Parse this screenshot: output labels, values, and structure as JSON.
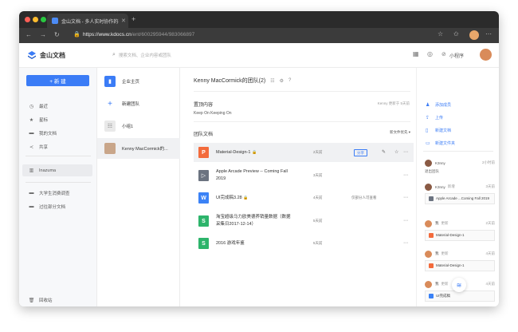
{
  "browser": {
    "tab_title": "金山文档 - 多人实时协作的在线",
    "url_host": "https://www.kdocs.cn",
    "url_path": "/ent/600295944/983066897"
  },
  "header": {
    "brand": "金山文档",
    "search_placeholder": "搜索文档、企业内容或团队",
    "mini_program": "小程序"
  },
  "sidebar": {
    "new_button": "+ 新 建",
    "items": [
      {
        "icon": "clock-icon",
        "label": "最近"
      },
      {
        "icon": "star-icon",
        "label": "星标"
      },
      {
        "icon": "folder-icon",
        "label": "我的文档"
      },
      {
        "icon": "share-icon",
        "label": "共享"
      }
    ],
    "workspace": "Inazuma",
    "folders": [
      {
        "icon": "folder-icon",
        "label": "大学生消费调查"
      },
      {
        "icon": "folder-icon",
        "label": "过往部分文档"
      }
    ],
    "trash": "回收站"
  },
  "teams": {
    "items": [
      {
        "icon": "building-icon",
        "label": "企业主页"
      },
      {
        "icon": "plus-icon",
        "label": "新建团队"
      },
      {
        "icon": "group-icon",
        "label": "小组1"
      },
      {
        "icon": "team-avatar-icon",
        "label": "Kenny MacCormick的..."
      }
    ]
  },
  "main": {
    "team_title": "Kenny MacCormick的团队(2)",
    "pinned_title": "置顶内容",
    "pinned_text": "Keep On Keeping On",
    "pinned_meta": "Kenny 更新于 5天前",
    "docs_title": "团队文档",
    "sort_label": "新文件优先 ▾",
    "share_label": "分享",
    "files": [
      {
        "icon_letter": "P",
        "color": "#f36b3c",
        "name": "Material-Design-1",
        "lock": "🔒",
        "date": "2天前",
        "perm": ""
      },
      {
        "icon_letter": "▷",
        "color": "#6b7380",
        "name": "Apple Arcade Preview -- Coming Fall 2019",
        "lock": "",
        "date": "3天前",
        "perm": ""
      },
      {
        "icon_letter": "W",
        "color": "#3b82f6",
        "name": "UI完成稿3.28",
        "lock": "🔒",
        "date": "4天前",
        "perm": "仅部分人可查看"
      },
      {
        "icon_letter": "S",
        "color": "#2db46b",
        "name": "淘宝超级马力欧美德养销量数据（数据采集日2017-12-14）",
        "lock": "",
        "date": "5天前",
        "perm": ""
      },
      {
        "icon_letter": "S",
        "color": "#2db46b",
        "name": "2016 游戏年鉴",
        "lock": "",
        "date": "5天前",
        "perm": ""
      }
    ]
  },
  "right_panel": {
    "actions": [
      {
        "icon": "add-member-icon",
        "label": "添加成员"
      },
      {
        "icon": "upload-icon",
        "label": "上传"
      },
      {
        "icon": "new-file-icon",
        "label": "新建文档"
      },
      {
        "icon": "new-folder-icon",
        "label": "新建文件夹"
      }
    ],
    "activities": [
      {
        "user": "K3nny",
        "action": "",
        "time": "2小时前",
        "body": "退出团队",
        "card": "",
        "avatar_color": "#8a5a44"
      },
      {
        "user": "K3nny",
        "action": "新增",
        "time": "3天前",
        "body": "",
        "card": "Apple Arcade ...Coming Fall 2019",
        "card_color": "#6b7380",
        "avatar_color": "#8a5a44"
      },
      {
        "user": "我",
        "action": "更新",
        "time": "2天前",
        "body": "",
        "card": "Material-Design-1",
        "card_color": "#f36b3c",
        "avatar_color": "#d98b5a"
      },
      {
        "user": "我",
        "action": "更新",
        "time": "4天前",
        "body": "",
        "card": "Material-Design-1",
        "card_color": "#f36b3c",
        "avatar_color": "#d98b5a"
      },
      {
        "user": "我",
        "action": "更新",
        "time": "4天前",
        "body": "",
        "card": "UI完成稿",
        "card_color": "#3b82f6",
        "avatar_color": "#d98b5a"
      }
    ]
  }
}
